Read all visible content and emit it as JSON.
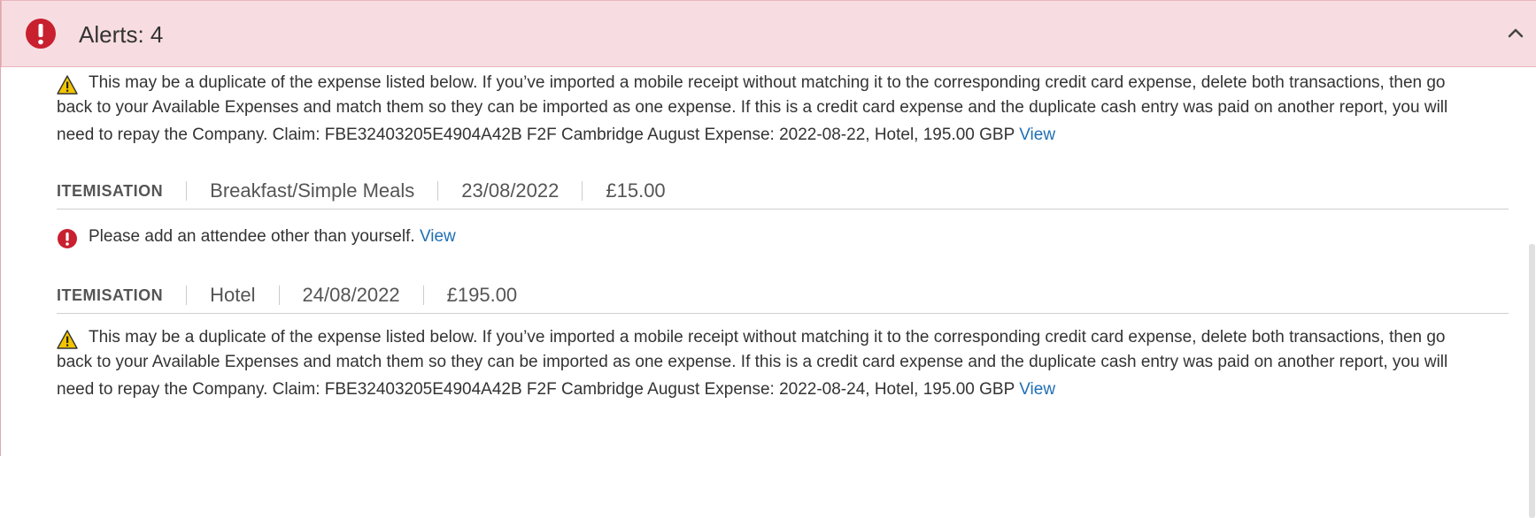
{
  "alerts_panel": {
    "title": "Alerts: 4",
    "header_icon": "alert-circle-icon",
    "collapse_icon": "chevron-up-icon",
    "colors": {
      "header_bg": "#f7dde1",
      "error": "#c8202f",
      "warning": "#f2c500",
      "link": "#1f6fb5"
    }
  },
  "alerts": [
    {
      "icon": "warning-triangle-icon",
      "line1": "This may be a duplicate of the expense listed below. If you’ve imported a mobile receipt without matching it to the corresponding credit card expense, delete both transactions, then go",
      "line2": "back to your Available Expenses and match them so they can be imported as one expense. If this is a credit card expense and the duplicate cash entry was paid on another report, you will",
      "line3": "need to repay the Company. Claim: FBE32403205E4904A42B F2F Cambridge August Expense: 2022-08-22, Hotel, 195.00 GBP",
      "link": "View"
    },
    {
      "icon": "error-circle-icon",
      "line1": "Please add an attendee other than yourself.",
      "link": "View"
    },
    {
      "icon": "warning-triangle-icon",
      "line1": "This may be a duplicate of the expense listed below. If you’ve imported a mobile receipt without matching it to the corresponding credit card expense, delete both transactions, then go",
      "line2": "back to your Available Expenses and match them so they can be imported as one expense. If this is a credit card expense and the duplicate cash entry was paid on another report, you will",
      "line3": "need to repay the Company. Claim: FBE32403205E4904A42B F2F Cambridge August Expense: 2022-08-24, Hotel, 195.00 GBP",
      "link": "View"
    }
  ],
  "itemisations": [
    {
      "label": "ITEMISATION",
      "type": "Breakfast/Simple Meals",
      "date": "23/08/2022",
      "amount": "£15.00"
    },
    {
      "label": "ITEMISATION",
      "type": "Hotel",
      "date": "24/08/2022",
      "amount": "£195.00"
    }
  ]
}
